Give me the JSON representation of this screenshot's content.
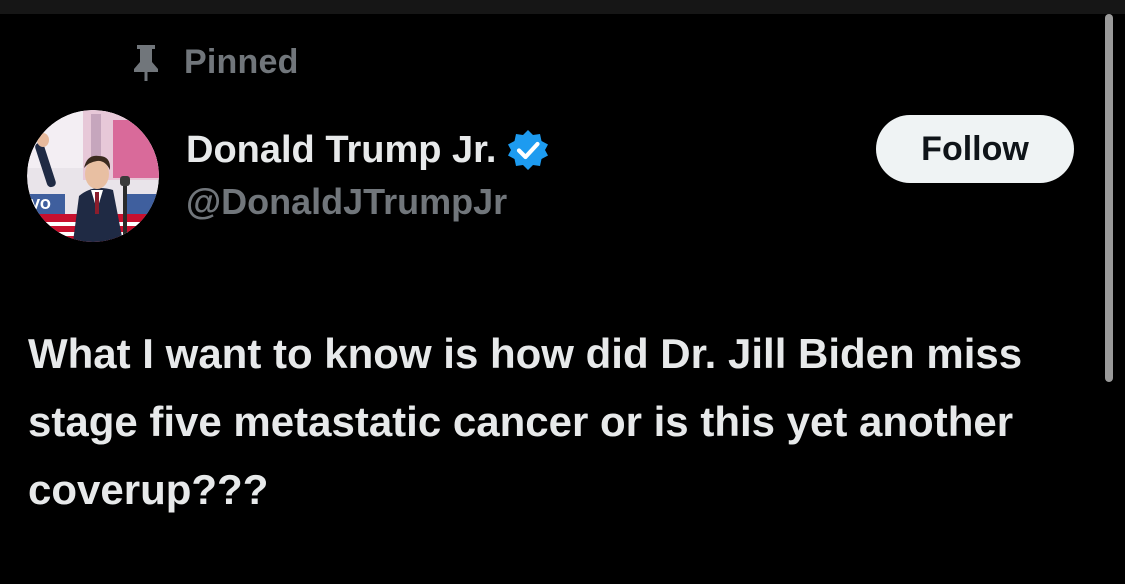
{
  "pinned": {
    "label": "Pinned",
    "icon": "pin-icon"
  },
  "author": {
    "display_name": "Donald Trump Jr.",
    "handle": "@DonaldJTrumpJr",
    "verified": true,
    "verified_icon": "verified-badge-icon",
    "verified_color": "#1d9bf0",
    "avatar": "avatar-image"
  },
  "follow_button": {
    "label": "Follow"
  },
  "tweet": {
    "text": "What I want to know is how did Dr. Jill Biden miss stage five metastatic cancer or is this yet another coverup???"
  },
  "colors": {
    "background": "#000000",
    "primary_text": "#e7e9ea",
    "secondary_text": "#71767b",
    "button_bg": "#eff3f4"
  }
}
